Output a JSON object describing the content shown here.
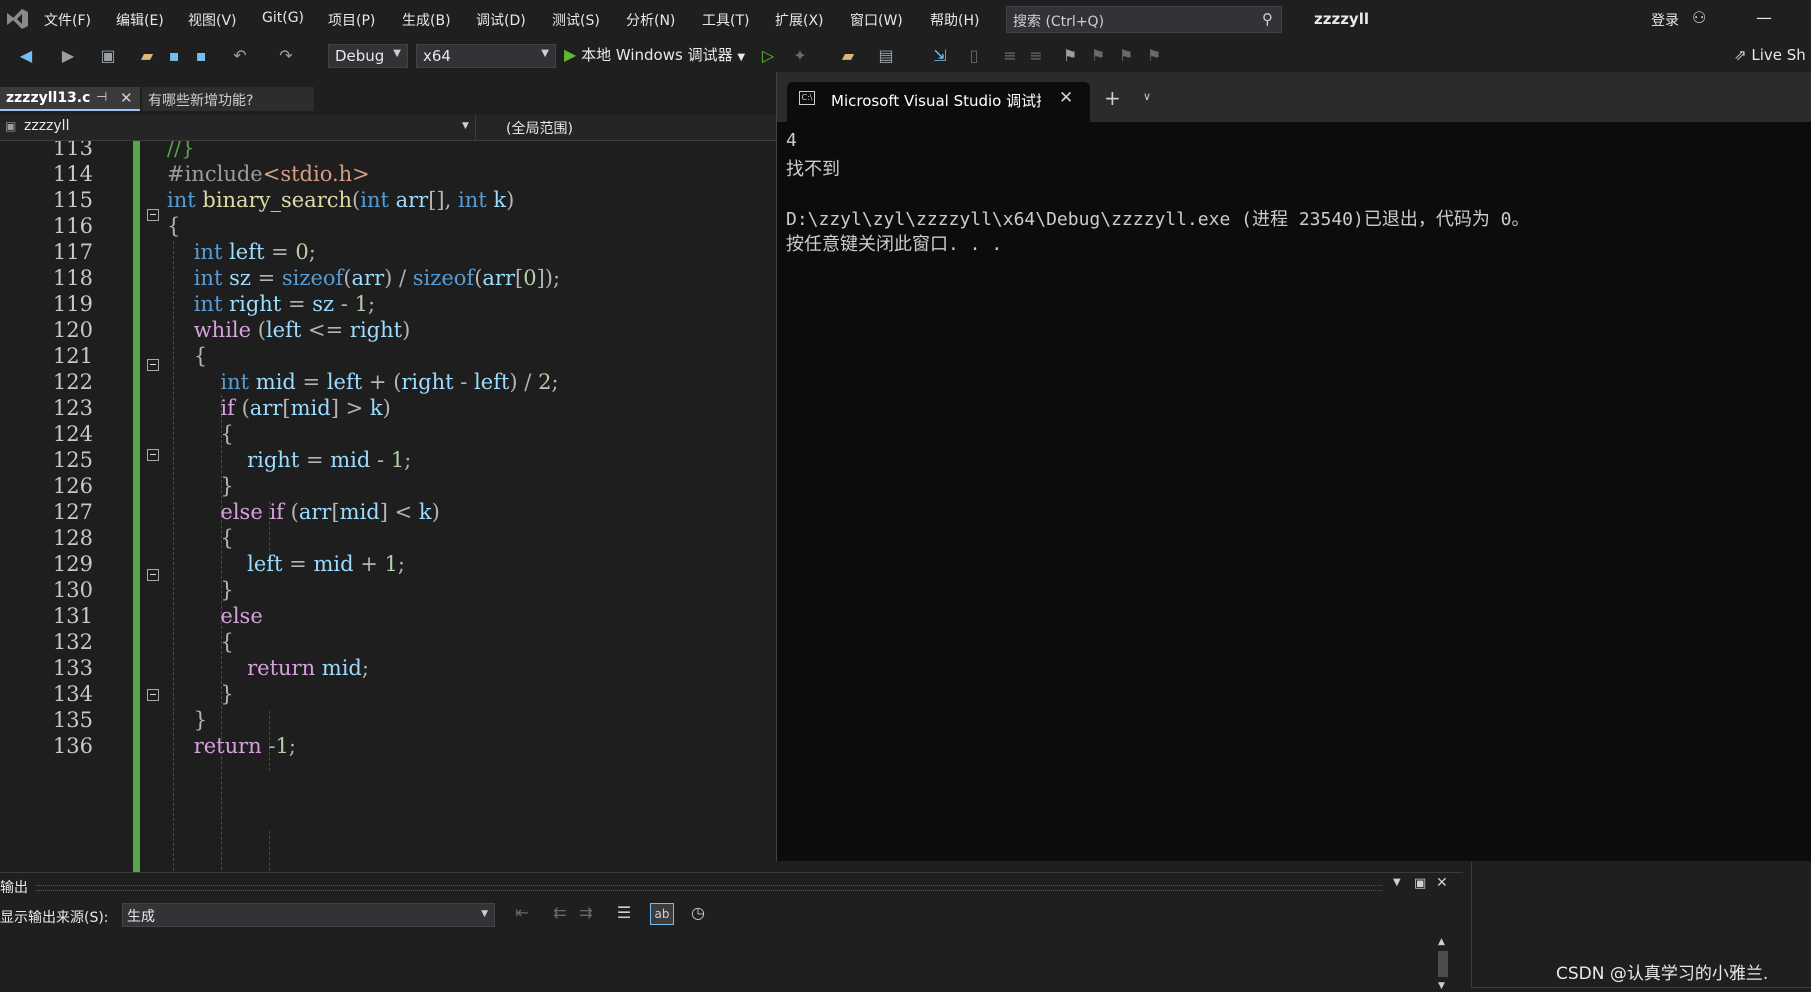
{
  "menubar": {
    "items": [
      "文件(F)",
      "编辑(E)",
      "视图(V)",
      "Git(G)",
      "项目(P)",
      "生成(B)",
      "调试(D)",
      "测试(S)",
      "分析(N)",
      "工具(T)",
      "扩展(X)",
      "窗口(W)",
      "帮助(H)"
    ],
    "search_placeholder": "搜索 (Ctrl+Q)",
    "solution_name": "zzzzyll",
    "login": "登录"
  },
  "toolbar": {
    "config": "Debug",
    "platform": "x64",
    "run_label": "本地 Windows 调试器",
    "live_share": "Live Sh"
  },
  "doc_tabs": [
    {
      "label": "zzzzyll13.c",
      "active": true
    },
    {
      "label": "有哪些新增功能?",
      "active": false
    }
  ],
  "navbar": {
    "project": "zzzzyll",
    "scope": "(全局范围)"
  },
  "editor": {
    "lines": [
      {
        "num": "113",
        "text": "//}"
      },
      {
        "num": "114",
        "text": "#include<stdio.h>"
      },
      {
        "num": "115",
        "text": "int binary_search(int arr[], int k)"
      },
      {
        "num": "116",
        "text": "{"
      },
      {
        "num": "117",
        "text": "    int left = 0;"
      },
      {
        "num": "118",
        "text": "    int sz = sizeof(arr) / sizeof(arr[0]);"
      },
      {
        "num": "119",
        "text": "    int right = sz - 1;"
      },
      {
        "num": "120",
        "text": "    while (left <= right)"
      },
      {
        "num": "121",
        "text": "    {"
      },
      {
        "num": "122",
        "text": "        int mid = left + (right - left) / 2;"
      },
      {
        "num": "123",
        "text": "        if (arr[mid] > k)"
      },
      {
        "num": "124",
        "text": "        {"
      },
      {
        "num": "125",
        "text": "            right = mid - 1;"
      },
      {
        "num": "126",
        "text": "        }"
      },
      {
        "num": "127",
        "text": "        else if (arr[mid] < k)"
      },
      {
        "num": "128",
        "text": "        {"
      },
      {
        "num": "129",
        "text": "            left = mid + 1;"
      },
      {
        "num": "130",
        "text": "        }"
      },
      {
        "num": "131",
        "text": "        else"
      },
      {
        "num": "132",
        "text": "        {"
      },
      {
        "num": "133",
        "text": "            return mid;"
      },
      {
        "num": "134",
        "text": "        }"
      },
      {
        "num": "135",
        "text": "    }"
      },
      {
        "num": "136",
        "text": "    return -1;"
      }
    ]
  },
  "console": {
    "tab_title": "Microsoft Visual Studio 调试控",
    "lines": [
      "4",
      "找不到",
      "",
      "D:\\zzyl\\zyl\\zzzzyll\\x64\\Debug\\zzzzyll.exe (进程 23540)已退出，代码为 0。",
      "按任意键关闭此窗口. . ."
    ]
  },
  "output": {
    "title": "输出",
    "source_label": "显示输出来源(S):",
    "source_value": "生成"
  },
  "watermark": "CSDN @认真学习的小雅兰."
}
